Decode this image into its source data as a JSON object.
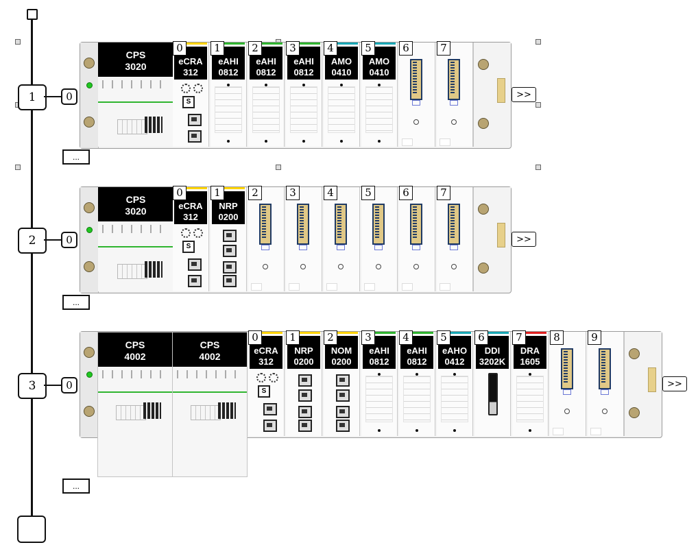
{
  "bus": {
    "drops": [
      {
        "label": "1",
        "rack": "0",
        "more": "..."
      },
      {
        "label": "2",
        "rack": "0",
        "more": "..."
      },
      {
        "label": "3",
        "rack": "0",
        "more": "..."
      }
    ],
    "expand_label": ">>"
  },
  "rack1": {
    "power": [
      {
        "line1": "CPS",
        "line2": "3020"
      }
    ],
    "modules": [
      {
        "slot": "0",
        "line1": "eCRA",
        "line2": "312",
        "bar": "#ffd400"
      },
      {
        "slot": "1",
        "line1": "eAHI",
        "line2": "0812",
        "bar": "#2fb52f"
      },
      {
        "slot": "2",
        "line1": "eAHI",
        "line2": "0812",
        "bar": "#2fb52f"
      },
      {
        "slot": "3",
        "line1": "eAHI",
        "line2": "0812",
        "bar": "#2fb52f"
      },
      {
        "slot": "4",
        "line1": "AMO",
        "line2": "0410",
        "bar": "#18a7b5"
      },
      {
        "slot": "5",
        "line1": "AMO",
        "line2": "0410",
        "bar": "#18a7b5"
      },
      {
        "slot": "6",
        "line1": "",
        "line2": "",
        "bar": ""
      },
      {
        "slot": "7",
        "line1": "",
        "line2": "",
        "bar": ""
      }
    ]
  },
  "rack2": {
    "power": [
      {
        "line1": "CPS",
        "line2": "3020"
      }
    ],
    "modules": [
      {
        "slot": "0",
        "line1": "eCRA",
        "line2": "312",
        "bar": "#ffd400"
      },
      {
        "slot": "1",
        "line1": "NRP",
        "line2": "0200",
        "bar": "#ffd400"
      },
      {
        "slot": "2",
        "line1": "",
        "line2": "",
        "bar": ""
      },
      {
        "slot": "3",
        "line1": "",
        "line2": "",
        "bar": ""
      },
      {
        "slot": "4",
        "line1": "",
        "line2": "",
        "bar": ""
      },
      {
        "slot": "5",
        "line1": "",
        "line2": "",
        "bar": ""
      },
      {
        "slot": "6",
        "line1": "",
        "line2": "",
        "bar": ""
      },
      {
        "slot": "7",
        "line1": "",
        "line2": "",
        "bar": ""
      }
    ]
  },
  "rack3": {
    "power": [
      {
        "line1": "CPS",
        "line2": "4002"
      },
      {
        "line1": "CPS",
        "line2": "4002"
      }
    ],
    "modules": [
      {
        "slot": "0",
        "line1": "eCRA",
        "line2": "312",
        "bar": "#ffd400"
      },
      {
        "slot": "1",
        "line1": "NRP",
        "line2": "0200",
        "bar": "#ffd400"
      },
      {
        "slot": "2",
        "line1": "NOM",
        "line2": "0200",
        "bar": "#ffd400"
      },
      {
        "slot": "3",
        "line1": "eAHI",
        "line2": "0812",
        "bar": "#2fb52f"
      },
      {
        "slot": "4",
        "line1": "eAHI",
        "line2": "0812",
        "bar": "#2fb52f"
      },
      {
        "slot": "5",
        "line1": "eAHO",
        "line2": "0412",
        "bar": "#18a7b5"
      },
      {
        "slot": "6",
        "line1": "DDI",
        "line2": "3202K",
        "bar": "#18a7b5"
      },
      {
        "slot": "7",
        "line1": "DRA",
        "line2": "1605",
        "bar": "#e02020"
      },
      {
        "slot": "8",
        "line1": "",
        "line2": "",
        "bar": ""
      },
      {
        "slot": "9",
        "line1": "",
        "line2": "",
        "bar": ""
      }
    ]
  }
}
